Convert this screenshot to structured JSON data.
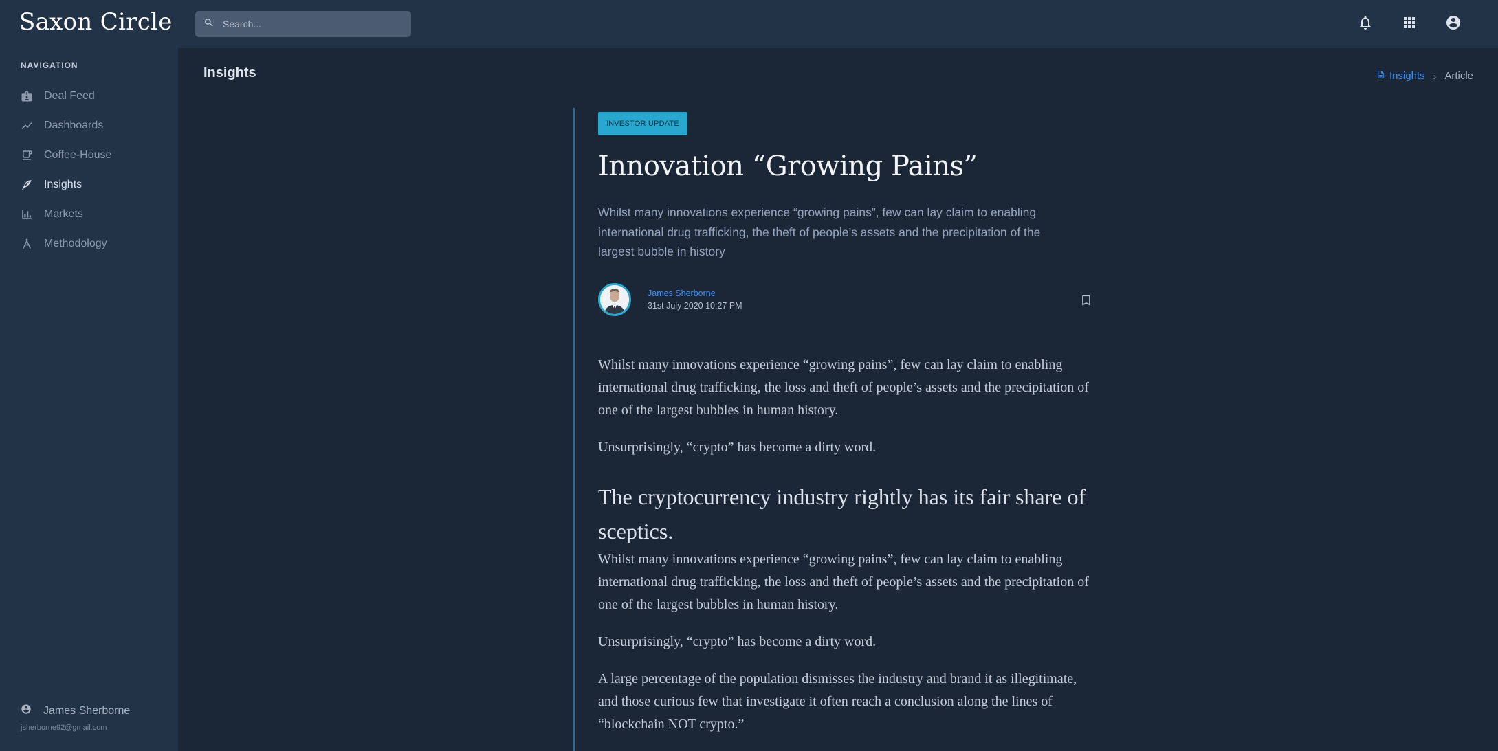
{
  "app": {
    "name": "Saxon Circle"
  },
  "sidebar": {
    "heading": "NAVIGATION",
    "items": [
      {
        "label": "Deal Feed",
        "icon": "badge-icon",
        "active": false
      },
      {
        "label": "Dashboards",
        "icon": "trend-line-icon",
        "active": false
      },
      {
        "label": "Coffee-House",
        "icon": "coffee-cup-icon",
        "active": false
      },
      {
        "label": "Insights",
        "icon": "feather-icon",
        "active": true
      },
      {
        "label": "Markets",
        "icon": "bar-chart-icon",
        "active": false
      },
      {
        "label": "Methodology",
        "icon": "compass-icon",
        "active": false
      }
    ],
    "user": {
      "name": "James Sherborne",
      "email": "jsherborne92@gmail.com"
    }
  },
  "topbar": {
    "search_placeholder": "Search...",
    "icons": [
      "bell-icon",
      "apps-grid-icon",
      "account-circle-icon"
    ]
  },
  "page": {
    "title": "Insights",
    "breadcrumb": {
      "link": "Insights",
      "current": "Article"
    }
  },
  "article": {
    "badge": "INVESTOR UPDATE",
    "title": "Innovation “Growing Pains”",
    "subtitle": "Whilst many innovations experience “growing pains”, few can lay claim to enabling international drug trafficking, the theft of people’s assets and the precipitation of the largest bubble in history",
    "author": "James Sherborne",
    "date": "31st July 2020 10:27 PM",
    "body": {
      "p1": "Whilst many innovations experience “growing pains”, few can lay claim to enabling international drug trafficking, the loss and theft of people’s assets and the precipitation of one of the largest bubbles in human history.",
      "p2": "Unsurprisingly, “crypto” has become a dirty word.",
      "heading": "The cryptocurrency industry rightly has its fair share of sceptics.",
      "p3": "Whilst many innovations experience “growing pains”, few can lay claim to enabling international drug trafficking, the loss and theft of people’s assets and the precipitation of one of the largest bubbles in human history.",
      "p4": "Unsurprisingly, “crypto” has become a dirty word.",
      "p5": "A large percentage of the population dismisses the industry and brand it as illegitimate, and those curious few that investigate it often reach a conclusion along the lines of “blockchain NOT crypto.”"
    }
  },
  "colors": {
    "accent": "#29a8cf",
    "link": "#3d8ff2",
    "background": "#1b2737",
    "sidebar": "#223247"
  }
}
